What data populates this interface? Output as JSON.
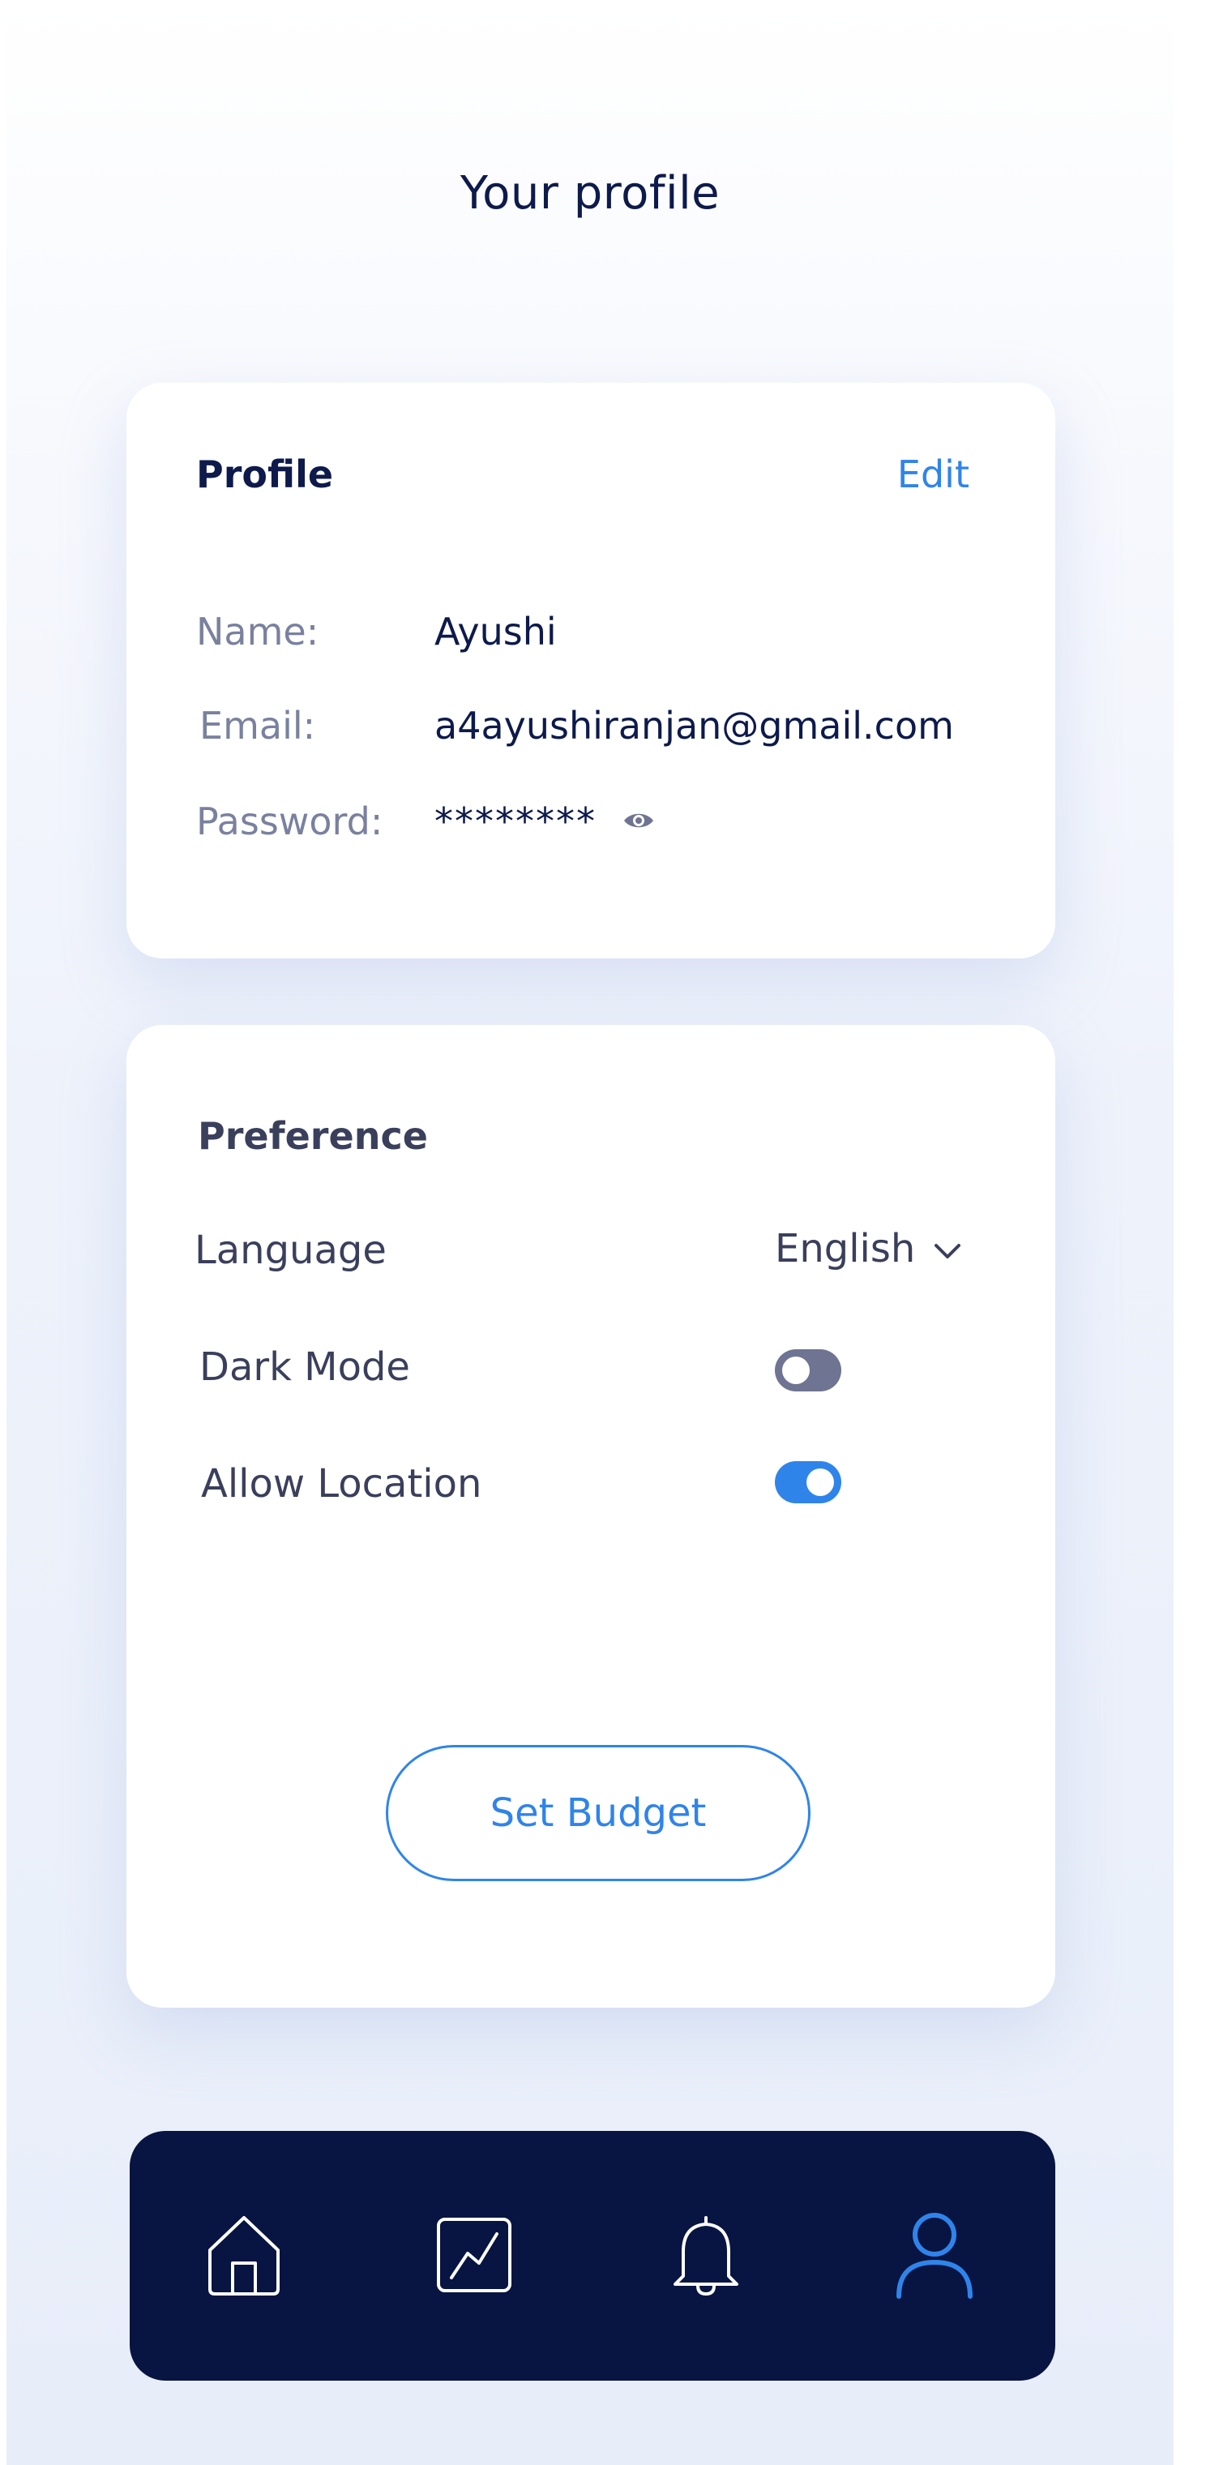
{
  "header": {
    "title": "Your profile"
  },
  "profile": {
    "heading": "Profile",
    "edit_label": "Edit",
    "name_label": "Name:",
    "name_value": "Ayushi",
    "email_label": "Email:",
    "email_value": "a4ayushiranjan@gmail.com",
    "password_label": "Password:",
    "password_value": "********",
    "password_toggle_icon": "eye-icon"
  },
  "preference": {
    "heading": "Preference",
    "language_label": "Language",
    "language_value": "English",
    "dark_mode_label": "Dark Mode",
    "dark_mode_enabled": false,
    "location_label": "Allow Location",
    "location_enabled": true,
    "budget_button_label": "Set Budget"
  },
  "nav": {
    "items": [
      {
        "icon": "home-icon",
        "active": false
      },
      {
        "icon": "chart-icon",
        "active": false
      },
      {
        "icon": "bell-icon",
        "active": false
      },
      {
        "icon": "user-icon",
        "active": true
      }
    ]
  },
  "colors": {
    "accent": "#2f84ea",
    "navy": "#081542",
    "toggle_off": "#6e7491"
  }
}
